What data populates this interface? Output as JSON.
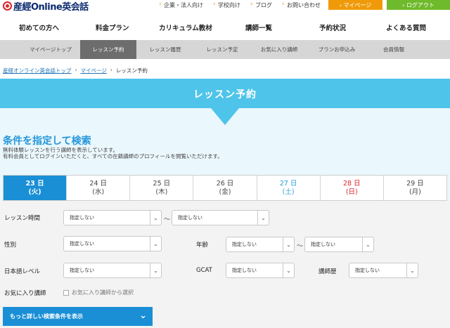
{
  "logo": {
    "text": "産經Online英会話"
  },
  "top_links": [
    "企業・法人向け",
    "学校向け",
    "ブログ",
    "お問い合わせ"
  ],
  "mypage_button": "› マイページ",
  "logout_button": "› ログアウト",
  "main_nav": [
    "初めての方へ",
    "料金プラン",
    "カリキュラム教材",
    "講師一覧",
    "予約状況",
    "よくある質問"
  ],
  "sub_nav": [
    "マイページトップ",
    "レッスン予約",
    "レッスン履歴",
    "レッスン予定",
    "お気に入り講師",
    "プランお申込み",
    "会員情報"
  ],
  "breadcrumb": {
    "home": "産経オンライン英会話トップ",
    "mypage": "マイページ",
    "current": "レッスン予約"
  },
  "banner_title": "レッスン予約",
  "section": {
    "title": "条件を指定して検索",
    "desc1": "無料体験レッスンを行う講師を表示しています。",
    "desc2": "有料会員としてログインいただくと、すべての在籍講師のプロフィールを閲覧いただけます。"
  },
  "dates": [
    {
      "day": "23 日",
      "wd": "(火)"
    },
    {
      "day": "24 日",
      "wd": "(水)"
    },
    {
      "day": "25 日",
      "wd": "(木)"
    },
    {
      "day": "26 日",
      "wd": "(金)"
    },
    {
      "day": "27 日",
      "wd": "(土)"
    },
    {
      "day": "28 日",
      "wd": "(日)"
    },
    {
      "day": "29 日",
      "wd": "(月)"
    }
  ],
  "form": {
    "lesson_time_label": "レッスン時間",
    "gender_label": "性別",
    "age_label": "年齢",
    "japanese_label": "日本語レベル",
    "gcat_label": "GCAT",
    "experience_label": "講師歴",
    "favorite_label": "お気に入り講師",
    "favorite_checkbox": "お気に入り講師から選択",
    "unspecified": "指定しない",
    "tilde": "〜"
  },
  "more_button": "もっと詳しい検索条件を表示",
  "colors": {
    "accent": "#1a8fd6",
    "banner": "#4ec4ea",
    "mypage": "#f09a0a",
    "logout": "#6fba2c"
  }
}
